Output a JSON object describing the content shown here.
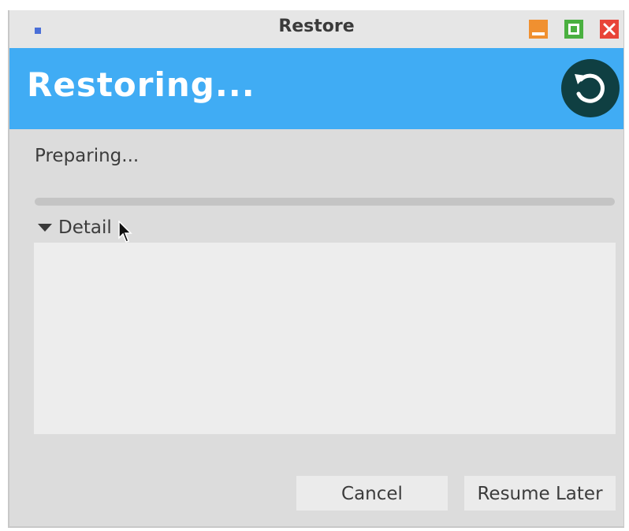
{
  "window": {
    "title": "Restore",
    "heading": "Restoring...",
    "icons": [
      "app-icon",
      "minimize-icon",
      "maximize-icon",
      "close-icon",
      "restore-icon"
    ]
  },
  "progress": {
    "status": "Preparing...",
    "value_fraction": 0
  },
  "detail": {
    "label": "Detail",
    "expanded": true,
    "content": ""
  },
  "buttons": {
    "cancel": "Cancel",
    "resume_later": "Resume Later"
  },
  "colors": {
    "banner": "#40acf4",
    "restore_icon_bg": "#0f3f42",
    "minimize": "#f09030",
    "maximize": "#4ab040",
    "close": "#e84438"
  }
}
